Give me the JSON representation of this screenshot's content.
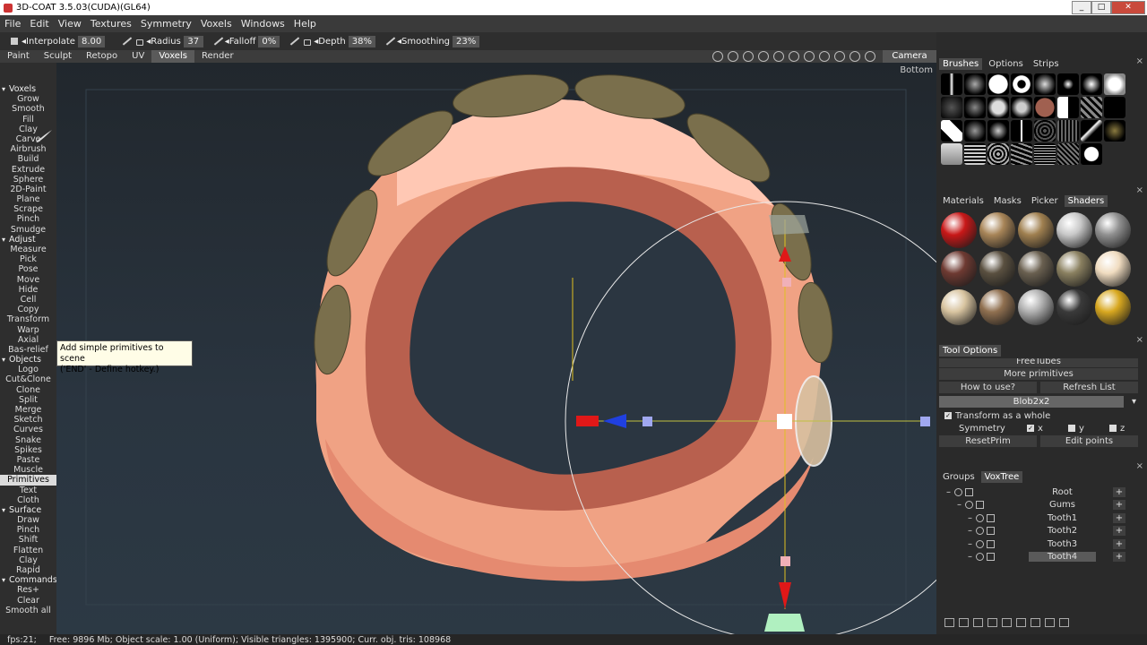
{
  "window": {
    "title": "3D-COAT 3.5.03(CUDA)(GL64)"
  },
  "menu": [
    "File",
    "Edit",
    "View",
    "Textures",
    "Symmetry",
    "Voxels",
    "Windows",
    "Help"
  ],
  "toolbar": {
    "interpolate_label": "Interpolate",
    "interpolate_value": "8.00",
    "radius_label": "Radius",
    "radius_value": "37",
    "falloff_label": "Falloff",
    "falloff_value": "0%",
    "depth_label": "Depth",
    "depth_value": "38%",
    "smoothing_label": "Smoothing",
    "smoothing_value": "23%"
  },
  "rooms": [
    "Paint",
    "Sculpt",
    "Retopo",
    "UV",
    "Voxels",
    "Render"
  ],
  "active_room": "Voxels",
  "camera_label": "Camera",
  "viewport": {
    "view_label": "Bottom"
  },
  "tools": [
    {
      "label": "Voxels",
      "header": true
    },
    {
      "label": "Grow"
    },
    {
      "label": "Smooth"
    },
    {
      "label": "Fill"
    },
    {
      "label": "Clay"
    },
    {
      "label": "Carve"
    },
    {
      "label": "Airbrush"
    },
    {
      "label": "Build"
    },
    {
      "label": "Extrude"
    },
    {
      "label": "Sphere"
    },
    {
      "label": "2D-Paint"
    },
    {
      "label": "Plane"
    },
    {
      "label": "Scrape"
    },
    {
      "label": "Pinch"
    },
    {
      "label": "Smudge"
    },
    {
      "label": "Adjust",
      "header": true
    },
    {
      "label": "Measure"
    },
    {
      "label": "Pick"
    },
    {
      "label": "Pose"
    },
    {
      "label": "Move"
    },
    {
      "label": "Hide"
    },
    {
      "label": "Cell"
    },
    {
      "label": "Copy"
    },
    {
      "label": "Transform"
    },
    {
      "label": "Warp"
    },
    {
      "label": "Axial"
    },
    {
      "label": "Bas-relief"
    },
    {
      "label": "Objects",
      "header": true
    },
    {
      "label": "Logo"
    },
    {
      "label": "Cut&Clone"
    },
    {
      "label": "Clone"
    },
    {
      "label": "Split"
    },
    {
      "label": "Merge"
    },
    {
      "label": "Sketch"
    },
    {
      "label": "Curves"
    },
    {
      "label": "Snake"
    },
    {
      "label": "Spikes"
    },
    {
      "label": "Paste"
    },
    {
      "label": "Muscle"
    },
    {
      "label": "Primitives",
      "selected": true
    },
    {
      "label": "Text"
    },
    {
      "label": "Cloth"
    },
    {
      "label": "Surface",
      "header": true
    },
    {
      "label": "Draw"
    },
    {
      "label": "Pinch"
    },
    {
      "label": "Shift"
    },
    {
      "label": "Flatten"
    },
    {
      "label": "Clay"
    },
    {
      "label": "Rapid"
    },
    {
      "label": "Commands",
      "header": true
    },
    {
      "label": "Res+"
    },
    {
      "label": "Clear"
    },
    {
      "label": "Smooth all"
    }
  ],
  "tooltip": {
    "line1": "Add simple primitives to scene",
    "line2": "('END' - Define hotkey.)"
  },
  "status": {
    "fps": "fps:21;",
    "info": "Free: 9896 Mb; Object scale: 1.00 (Uniform); Visible triangles: 1395900; Curr. obj. tris: 108968"
  },
  "brush_panel": {
    "tabs": [
      "Brushes",
      "Options",
      "Strips"
    ],
    "active": "Brushes",
    "close": "×"
  },
  "material_panel": {
    "tabs": [
      "Materials",
      "Masks",
      "Picker",
      "Shaders"
    ],
    "active": "Shaders",
    "close": "×",
    "shader_colors": [
      "#c81818",
      "#a88558",
      "#a08050",
      "#c8c8c8",
      "#909090",
      "#6e3a32",
      "#5a5040",
      "#6a6050",
      "#8a8060",
      "#f0dcc0",
      "#d8c4a0",
      "#907050",
      "#b0b0b0",
      "#3a3a3a",
      "#d8a820"
    ]
  },
  "tool_options": {
    "title": "Tool Options",
    "close": "×",
    "partial": "FreeTubes",
    "more_primitives": "More primitives",
    "how_to_use": "How to use?",
    "refresh_list": "Refresh List",
    "primitive_select": "Blob2x2",
    "transform_whole": "Transform as a whole",
    "symmetry": "Symmetry",
    "sym_x": "x",
    "sym_y": "y",
    "sym_z": "z",
    "reset_prim": "ResetPrim",
    "edit_points": "Edit points"
  },
  "voxtree_panel": {
    "tabs": [
      "Groups",
      "VoxTree"
    ],
    "active": "VoxTree",
    "close": "×",
    "nodes": [
      {
        "label": "Root",
        "depth": 0
      },
      {
        "label": "Gums",
        "depth": 1
      },
      {
        "label": "Tooth1",
        "depth": 2
      },
      {
        "label": "Tooth2",
        "depth": 2
      },
      {
        "label": "Tooth3",
        "depth": 2
      },
      {
        "label": "Tooth4",
        "depth": 2,
        "selected": true
      }
    ],
    "plus": "+"
  },
  "winbtns": {
    "min": "_",
    "max": "□",
    "close": "✕"
  }
}
